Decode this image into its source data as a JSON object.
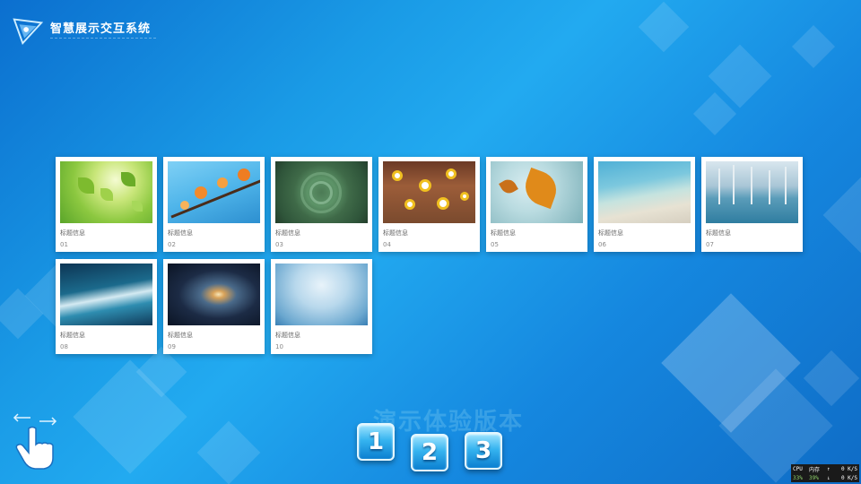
{
  "header": {
    "title": "智慧展示交互系统"
  },
  "gallery": {
    "items": [
      {
        "title": "标题信息",
        "num": "01"
      },
      {
        "title": "标题信息",
        "num": "02"
      },
      {
        "title": "标题信息",
        "num": "03"
      },
      {
        "title": "标题信息",
        "num": "04"
      },
      {
        "title": "标题信息",
        "num": "05"
      },
      {
        "title": "标题信息",
        "num": "06"
      },
      {
        "title": "标题信息",
        "num": "07"
      },
      {
        "title": "标题信息",
        "num": "08"
      },
      {
        "title": "标题信息",
        "num": "09"
      },
      {
        "title": "标题信息",
        "num": "10"
      }
    ]
  },
  "watermark": {
    "text": "演示体验版本"
  },
  "pager": {
    "pages": [
      "1",
      "2",
      "3"
    ],
    "active": "1"
  },
  "monitor": {
    "cpu_label": "CPU",
    "mem_label": "内存",
    "cpu_value": "33%",
    "mem_value": "39%",
    "up_speed": "0 K/S",
    "down_speed": "0 K/S"
  },
  "icons": {
    "logo": "logo-icon",
    "gesture": "swipe-hand-icon"
  }
}
